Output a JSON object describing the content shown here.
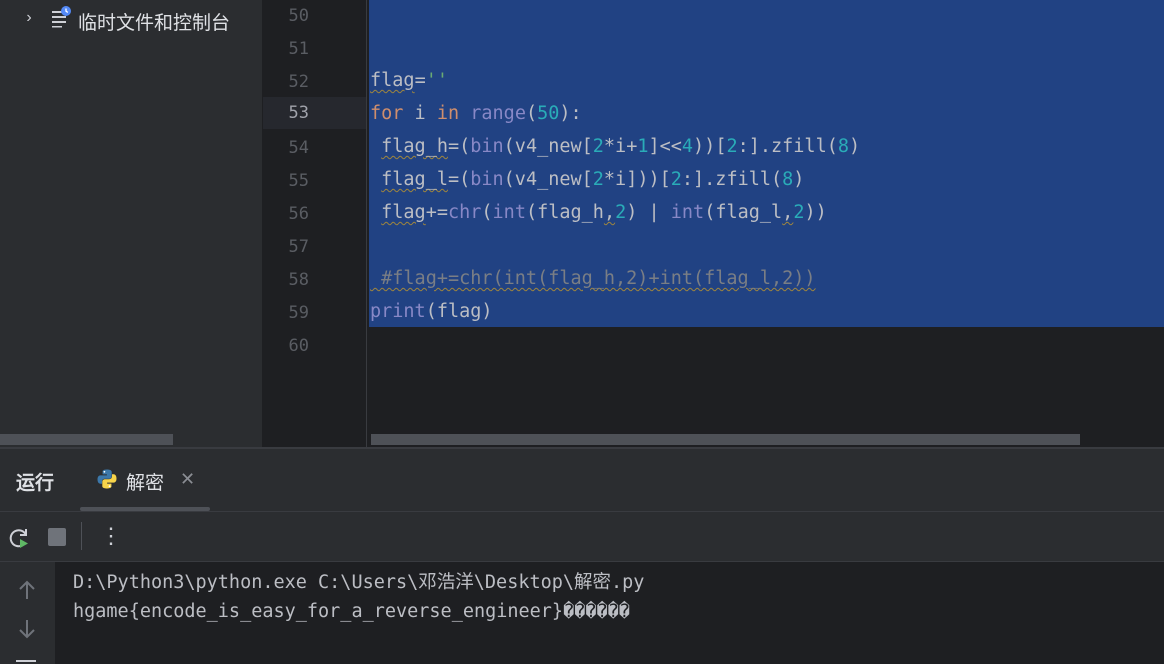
{
  "project_tree": {
    "item_label": "临时文件和控制台",
    "chevron_icon": "chevron-right-icon",
    "item_icon": "scratches-icon"
  },
  "editor": {
    "line_numbers": [
      "50",
      "51",
      "52",
      "53",
      "54",
      "55",
      "56",
      "57",
      "58",
      "59",
      "60"
    ],
    "current_line": "53",
    "lines": {
      "l52": "flag=''",
      "l53": "for i in range(50):",
      "l54": " flag_h=(bin(v4_new[2*i+1]<<4))[2:].zfill(8)",
      "l55": " flag_l=(bin(v4_new[2*i]))[2:].zfill(8)",
      "l56": " flag+=chr(int(flag_h,2) | int(flag_l,2))",
      "l58": " #flag+=chr(int(flag_h,2)+int(flag_l,2))",
      "l59": "print(flag)"
    }
  },
  "run_panel": {
    "title": "运行",
    "tab_label": "解密",
    "tab_icon": "python-icon",
    "close_icon": "close-icon",
    "toolbar": {
      "rerun_icon": "rerun-icon",
      "stop_icon": "stop-icon",
      "more_icon": "more-vertical-icon"
    },
    "console": {
      "command_line": "D:\\Python3\\python.exe C:\\Users\\邓浩洋\\Desktop\\解密.py",
      "output_line": "hgame{encode_is_easy_for_a_reverse_engineer}������"
    }
  },
  "colors": {
    "selection": "#214283",
    "keyword": "#cf8e6d",
    "builtin": "#8888c6",
    "number": "#2aacb8",
    "string": "#6aab73",
    "comment": "#7a7e85"
  }
}
